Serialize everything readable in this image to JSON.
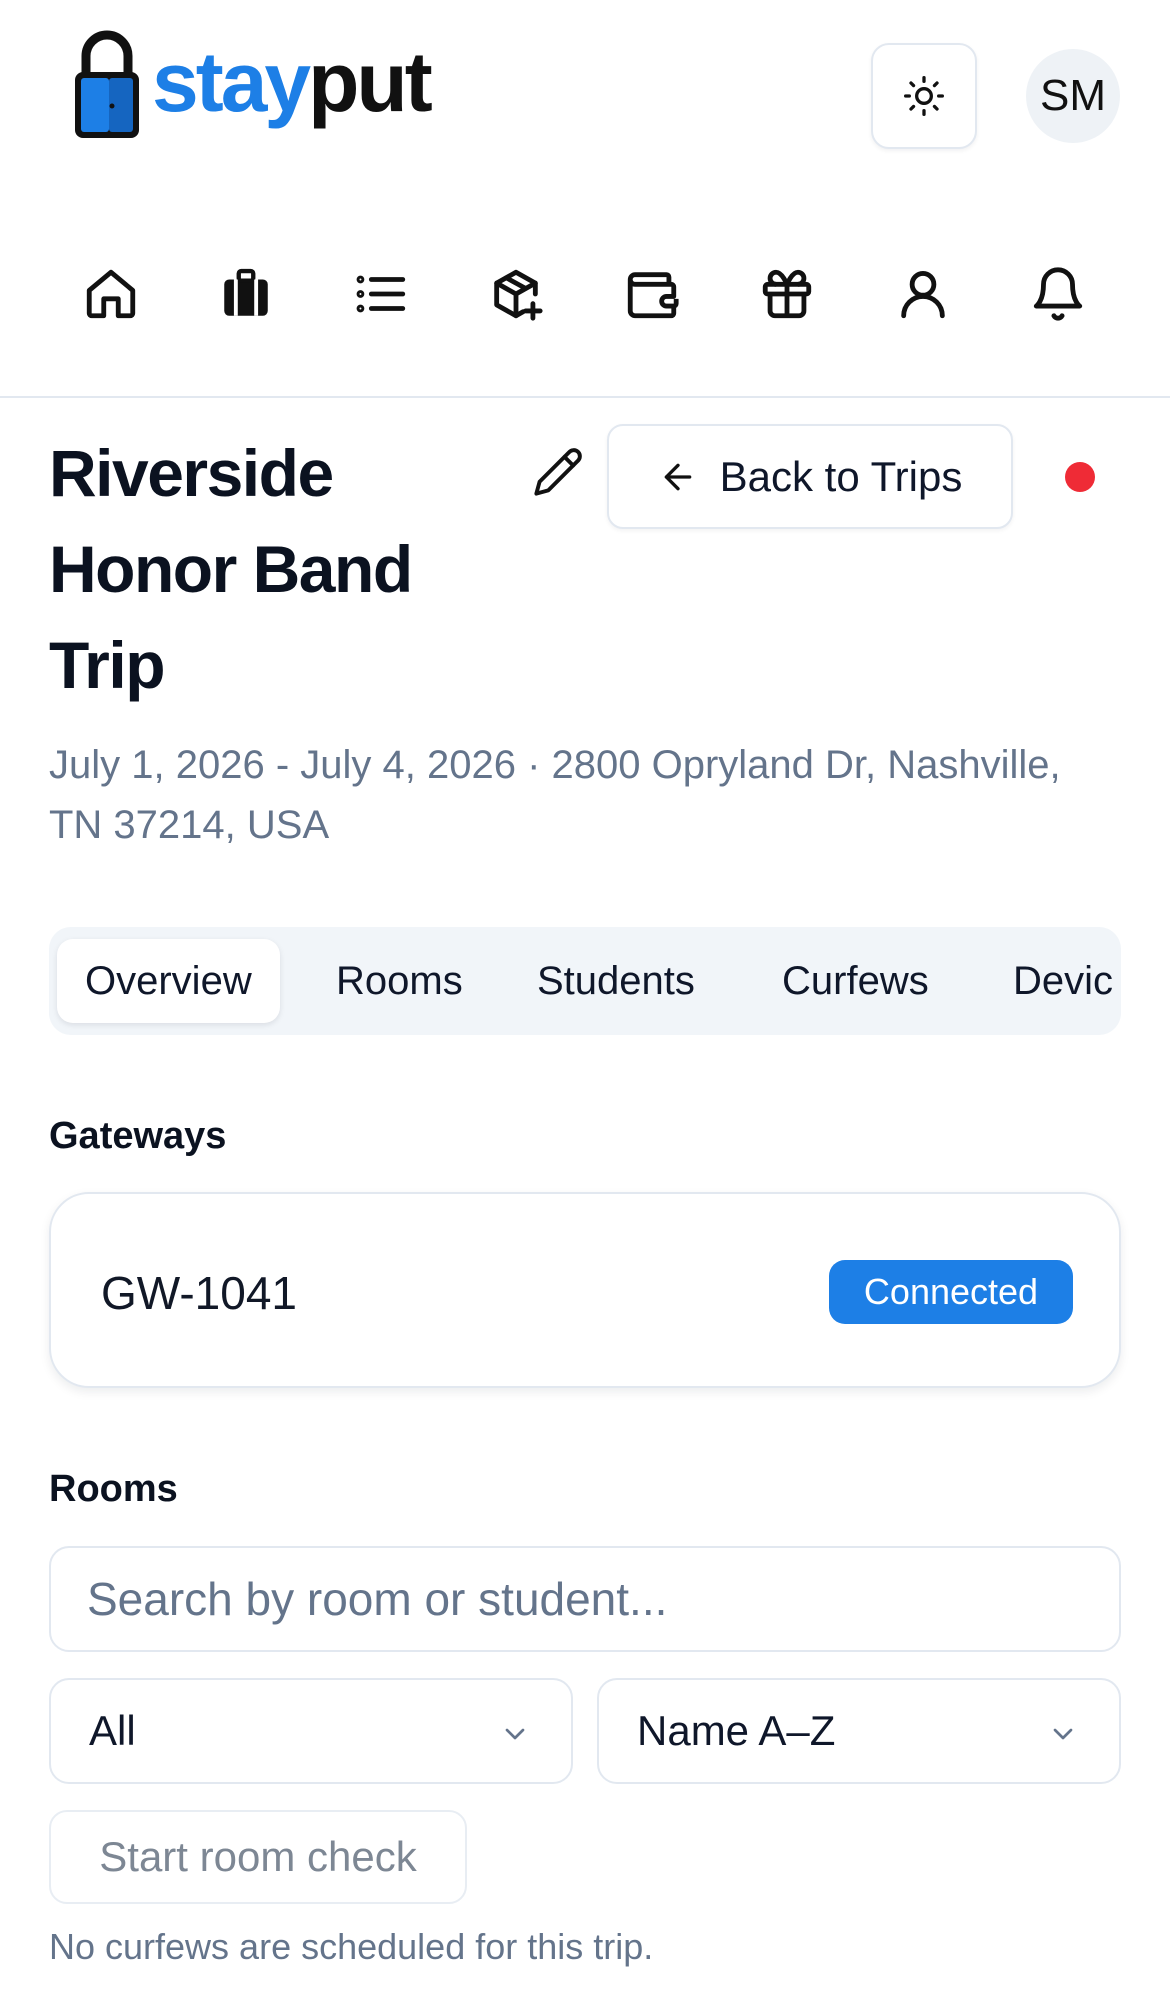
{
  "brand": {
    "name_part1": "stay",
    "name_part2": "put",
    "logo_icon": "padlock-logo"
  },
  "header": {
    "theme_icon": "sun-icon",
    "avatar_initials": "SM"
  },
  "nav": {
    "items": [
      {
        "icon": "home-icon"
      },
      {
        "icon": "luggage-icon"
      },
      {
        "icon": "list-icon"
      },
      {
        "icon": "package-plus-icon"
      },
      {
        "icon": "wallet-icon"
      },
      {
        "icon": "gift-icon"
      },
      {
        "icon": "user-icon"
      },
      {
        "icon": "bell-icon"
      }
    ]
  },
  "trip": {
    "title": "Riverside Honor Band Trip",
    "meta": "July 1, 2026 - July 4, 2026 · 2800 Opryland Dr, Nashville, TN 37214, USA",
    "back_label": "Back to Trips",
    "status_color": "#ef2b36"
  },
  "tabs": [
    {
      "label": "Overview",
      "active": true
    },
    {
      "label": "Rooms"
    },
    {
      "label": "Students"
    },
    {
      "label": "Curfews"
    },
    {
      "label": "Devic"
    }
  ],
  "gateways": {
    "heading": "Gateways",
    "items": [
      {
        "id": "GW-1041",
        "status": "Connected",
        "status_color": "#1d7fe6"
      }
    ]
  },
  "rooms": {
    "heading": "Rooms",
    "search_placeholder": "Search by room or student...",
    "filter_value": "All",
    "sort_value": "Name A–Z",
    "room_check_label": "Start room check",
    "curfew_note": "No curfews are scheduled for this trip."
  }
}
